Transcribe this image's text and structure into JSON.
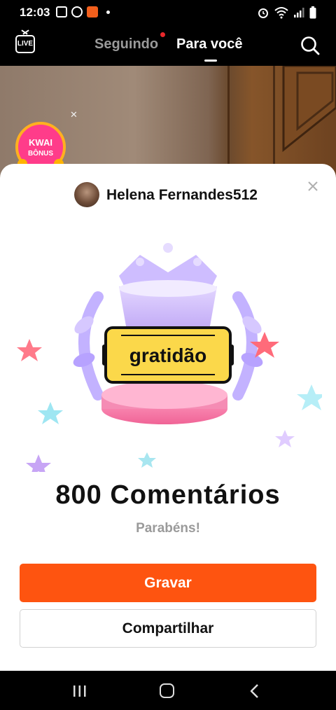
{
  "status_bar": {
    "time": "12:03",
    "left_icons": [
      "gallery-icon",
      "whatsapp-icon",
      "go-app-icon",
      "notification-dot-icon"
    ],
    "right_icons": [
      "alarm-icon",
      "wifi-icon",
      "signal-icon",
      "battery-icon"
    ]
  },
  "top_nav": {
    "live_label": "LIVE",
    "tabs": [
      {
        "label": "Seguindo",
        "active": false,
        "has_notification_dot": true
      },
      {
        "label": "Para você",
        "active": true
      }
    ]
  },
  "bonus_badge": {
    "line1": "KWAI",
    "line2": "BÔNUS"
  },
  "sheet": {
    "username": "Helena Fernandes512",
    "stamp_text": "gratidão",
    "achievement": "800 Comentários",
    "congrats": "Parabéns!",
    "primary_button": "Gravar",
    "secondary_button": "Compartilhar"
  },
  "colors": {
    "accent": "#fe5410",
    "stamp_yellow": "#fbd84a",
    "notification_red": "#e8282b"
  }
}
